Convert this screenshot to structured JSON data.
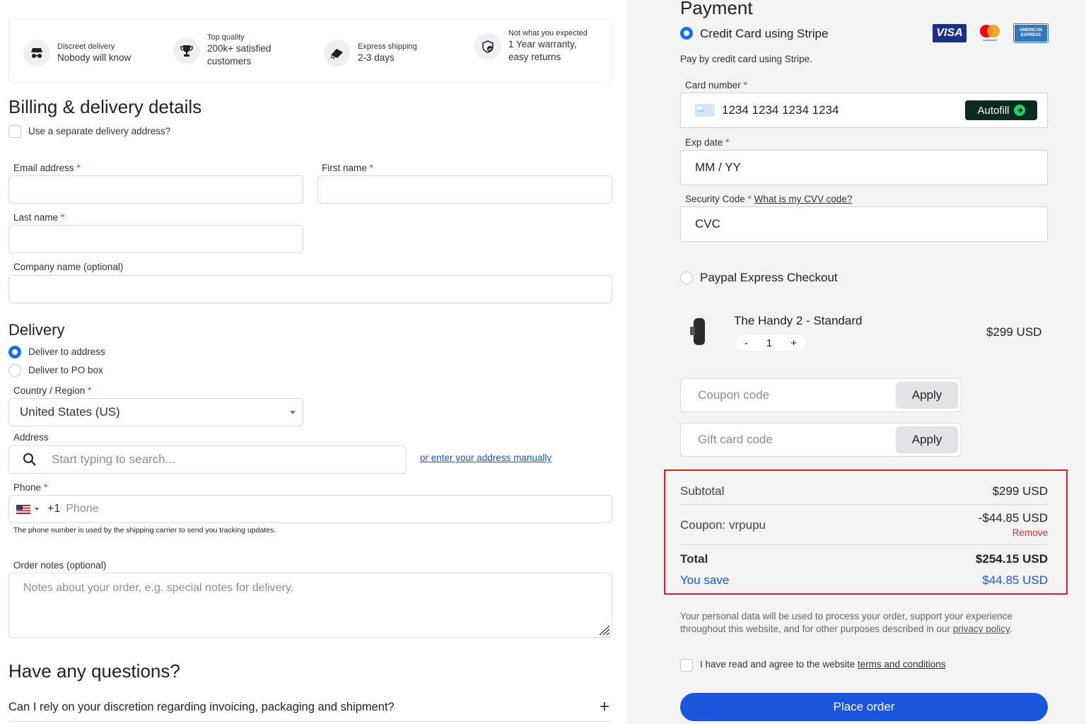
{
  "features": [
    {
      "icon": "incognito-icon",
      "small": "Discreet delivery",
      "big": "Nobody will know"
    },
    {
      "icon": "trophy-icon",
      "small": "Top quality",
      "big": "200k+ satisfied customers"
    },
    {
      "icon": "truck-icon",
      "small": "Express shipping",
      "big": "2-3 days"
    },
    {
      "icon": "shield-check-icon",
      "small": "Not what you expected",
      "big": "1 Year warranty, easy returns"
    }
  ],
  "billing": {
    "title": "Billing & delivery details",
    "separate_delivery": "Use a separate delivery address?",
    "email_label": "Email address",
    "first_name_label": "First name",
    "last_name_label": "Last name",
    "company_label": "Company name (optional)",
    "required_mark": "*"
  },
  "delivery": {
    "title": "Delivery",
    "option_address": "Deliver to address",
    "option_po": "Deliver to PO box",
    "country_label": "Country / Region",
    "country_value": "United States (US)",
    "address_label": "Address",
    "address_placeholder": "Start typing to search...",
    "manual_link": "or enter your address manually",
    "phone_label": "Phone",
    "phone_code": "+1",
    "phone_placeholder": "Phone",
    "phone_note": "The phone number is used by the shipping carrier to send you tracking updates.",
    "notes_label": "Order notes (optional)",
    "notes_placeholder": "Notes about your order, e.g. special notes for delivery."
  },
  "faq": {
    "title": "Have any questions?",
    "q1": "Can I rely on your discretion regarding invoicing, packaging and shipment?",
    "expand": "+"
  },
  "payment": {
    "title": "Payment",
    "method_stripe": "Credit Card using Stripe",
    "stripe_desc": "Pay by credit card using Stripe.",
    "card_logos": {
      "visa": "VISA",
      "mastercard": "mastercard",
      "amex": "AMERICAN EXPRESS"
    },
    "card_number_label": "Card number",
    "card_number_placeholder": "1234 1234 1234 1234",
    "autofill": "Autofill",
    "exp_label": "Exp date",
    "exp_placeholder": "MM / YY",
    "cvc_label": "Security Code",
    "cvc_help": "What is my CVV code?",
    "cvc_placeholder": "CVC",
    "method_paypal": "Paypal Express Checkout"
  },
  "order": {
    "product_name": "The Handy 2 - Standard",
    "product_price": "$299 USD",
    "qty_minus": "-",
    "qty": "1",
    "qty_plus": "+",
    "coupon_placeholder": "Coupon code",
    "gift_placeholder": "Gift card code",
    "apply": "Apply",
    "subtotal_label": "Subtotal",
    "subtotal_value": "$299 USD",
    "coupon_label": "Coupon: vrpupu",
    "coupon_value": "-$44.85 USD",
    "coupon_remove": "Remove",
    "total_label": "Total",
    "total_value": "$254.15 USD",
    "save_label": "You save",
    "save_value": "$44.85 USD",
    "privacy_text": "Your personal data will be used to process your order, support your experience throughout this website, and for other purposes described in our",
    "privacy_link": "privacy policy",
    "privacy_end": ".",
    "terms_text": "I have read and agree to the website",
    "terms_link": "terms and conditions",
    "place_order": "Place order"
  },
  "colors": {
    "accent": "#1a56db",
    "highlight_box": "#d6202a",
    "remove": "#d33333",
    "autofill_bg": "#0b2b1c"
  }
}
